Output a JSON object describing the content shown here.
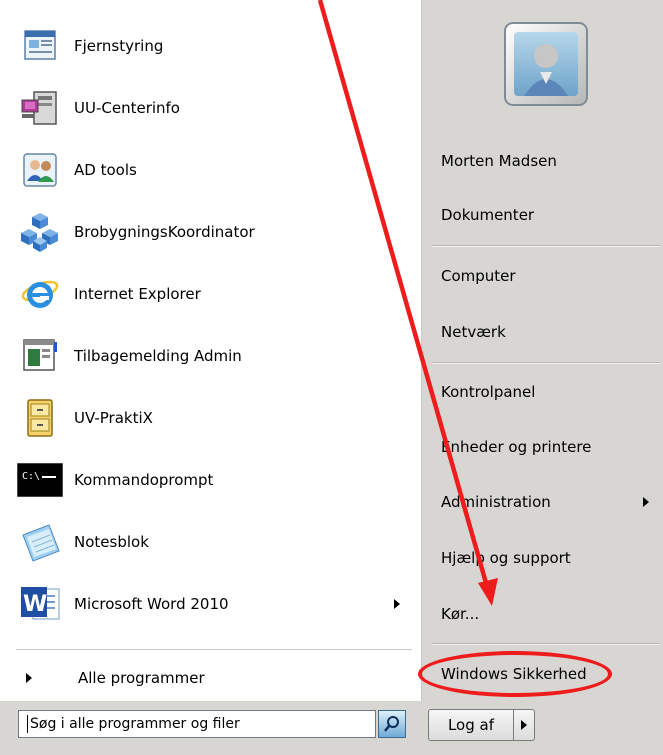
{
  "programs": [
    {
      "label": "Fjernstyring",
      "icon": "remote-desktop-icon"
    },
    {
      "label": "UU-Centerinfo",
      "icon": "network-pc-icon"
    },
    {
      "label": "AD tools",
      "icon": "users-icon"
    },
    {
      "label": "BrobygningsKoordinator",
      "icon": "cubes-icon"
    },
    {
      "label": "Internet Explorer",
      "icon": "internet-explorer-icon"
    },
    {
      "label": "Tilbagemelding Admin",
      "icon": "admin-window-icon"
    },
    {
      "label": "UV-PraktiX",
      "icon": "file-cabinet-icon"
    },
    {
      "label": "Kommandoprompt",
      "icon": "command-prompt-icon"
    },
    {
      "label": "Notesblok",
      "icon": "notepad-icon"
    },
    {
      "label": "Microsoft Word 2010",
      "icon": "word-icon",
      "has_submenu": true
    }
  ],
  "all_programs_label": "Alle programmer",
  "right_items": [
    {
      "label": "Morten Madsen"
    },
    {
      "label": "Dokumenter"
    },
    {
      "label": "Computer"
    },
    {
      "label": "Netværk"
    },
    {
      "label": "Kontrolpanel"
    },
    {
      "label": "Enheder og printere"
    },
    {
      "label": "Administration",
      "has_submenu": true
    },
    {
      "label": "Hjælp og support"
    },
    {
      "label": "Kør..."
    },
    {
      "label": "Windows Sikkerhed"
    }
  ],
  "search": {
    "placeholder": "Søg i alle programmer og filer",
    "value": ""
  },
  "logoff_label": "Log af",
  "colors": {
    "annotation": "#ee1c1c",
    "pane_right": "#d8d6d3"
  }
}
